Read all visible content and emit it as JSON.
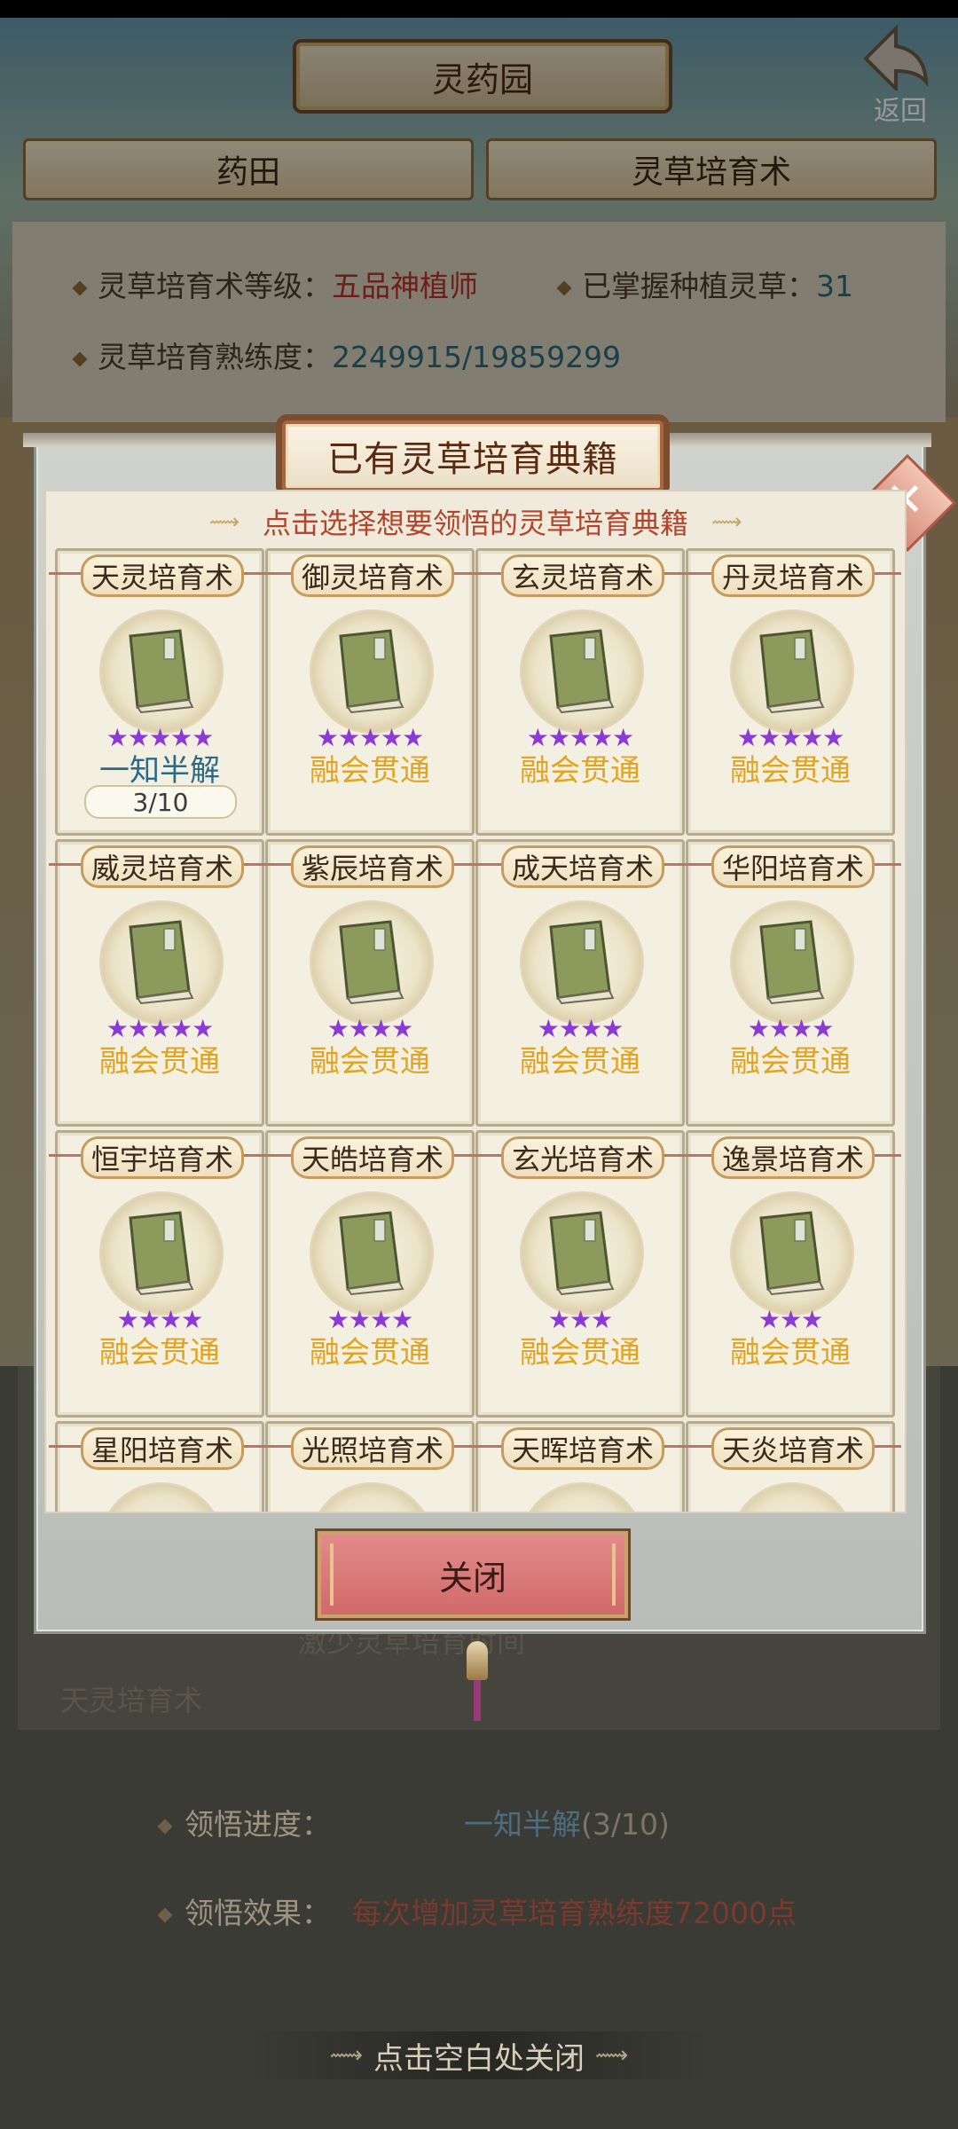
{
  "header": {
    "title": "灵药园",
    "back_label": "返回"
  },
  "tabs": [
    {
      "label": "药田"
    },
    {
      "label": "灵草培育术"
    }
  ],
  "info": {
    "level_label": "灵草培育术等级：",
    "level_value": "五品神植师",
    "mastered_label": "已掌握种植灵草：",
    "mastered_value": "31",
    "proficiency_label": "灵草培育熟练度：",
    "proficiency_value": "2249915/19859299"
  },
  "modal": {
    "title": "已有灵草培育典籍",
    "subtitle": "点击选择想要领悟的灵草培育典籍",
    "close_button": "关闭",
    "books": [
      {
        "name": "天灵培育术",
        "stars": "★★★★★",
        "level": "一知半解",
        "progress": "3/10"
      },
      {
        "name": "御灵培育术",
        "stars": "★★★★★",
        "level": "融会贯通"
      },
      {
        "name": "玄灵培育术",
        "stars": "★★★★★",
        "level": "融会贯通"
      },
      {
        "name": "丹灵培育术",
        "stars": "★★★★★",
        "level": "融会贯通"
      },
      {
        "name": "威灵培育术",
        "stars": "★★★★★",
        "level": "融会贯通"
      },
      {
        "name": "紫辰培育术",
        "stars": "★★★★",
        "level": "融会贯通"
      },
      {
        "name": "成天培育术",
        "stars": "★★★★",
        "level": "融会贯通"
      },
      {
        "name": "华阳培育术",
        "stars": "★★★★",
        "level": "融会贯通"
      },
      {
        "name": "恒宇培育术",
        "stars": "★★★★",
        "level": "融会贯通"
      },
      {
        "name": "天皓培育术",
        "stars": "★★★★",
        "level": "融会贯通"
      },
      {
        "name": "玄光培育术",
        "stars": "★★★",
        "level": "融会贯通"
      },
      {
        "name": "逸景培育术",
        "stars": "★★★",
        "level": "融会贯通"
      },
      {
        "name": "星阳培育术"
      },
      {
        "name": "光照培育术"
      },
      {
        "name": "天晖培育术"
      },
      {
        "name": "天炎培育术"
      }
    ]
  },
  "behind": {
    "book_label": "天灵培育术",
    "note_fragment": "激少灵草培育时间",
    "progress_label": "领悟进度：",
    "progress_level": "一知半解",
    "progress_count": "(3/10)",
    "effect_label": "领悟效果：",
    "effect_value": "每次增加灵草培育熟练度72000点"
  },
  "footer": {
    "hint": "点击空白处关闭"
  },
  "colors": {
    "accent_red": "#b8302a",
    "gold": "#e0a524",
    "teal": "#2b6a86",
    "star_purple": "#8b3ad6"
  }
}
